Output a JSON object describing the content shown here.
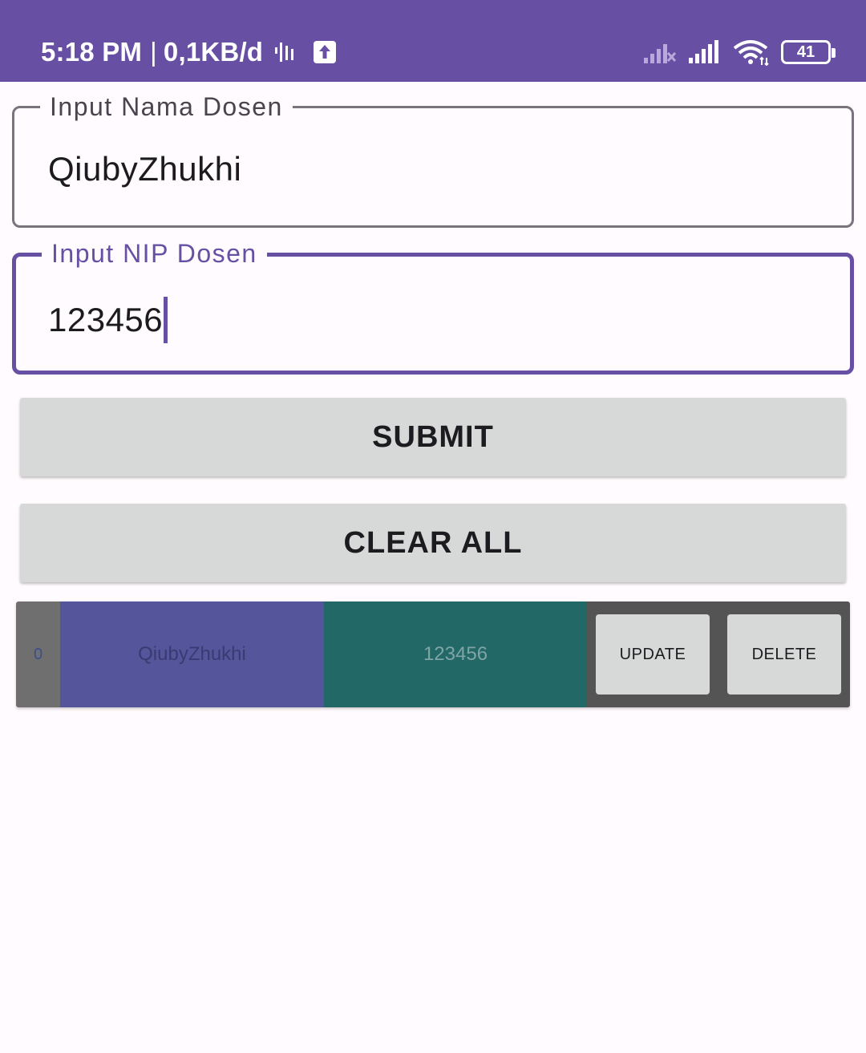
{
  "status_bar": {
    "time": "5:18 PM",
    "separator": "|",
    "network_speed": "0,1KB/d",
    "battery_level": "41",
    "icons": [
      "activity-icon",
      "upload-icon",
      "no-signal-icon",
      "signal-icon",
      "wifi-icon",
      "battery-icon"
    ],
    "background_color": "#6750a4"
  },
  "form": {
    "nama_field": {
      "label": "Input Nama Dosen",
      "value": "QiubyZhukhi"
    },
    "nip_field": {
      "label": "Input NIP Dosen",
      "value": "123456",
      "focused": true
    },
    "submit_label": "SUBMIT",
    "clear_label": "CLEAR ALL"
  },
  "list": {
    "rows": [
      {
        "index": "0",
        "name": "QiubyZhukhi",
        "nip": "123456",
        "update_label": "UPDATE",
        "delete_label": "DELETE"
      }
    ]
  },
  "colors": {
    "accent": "#6750a4",
    "button_bg": "#d7d9d8",
    "name_cell": "#54559a",
    "nip_cell": "#226866",
    "actions_cell": "#545454"
  }
}
